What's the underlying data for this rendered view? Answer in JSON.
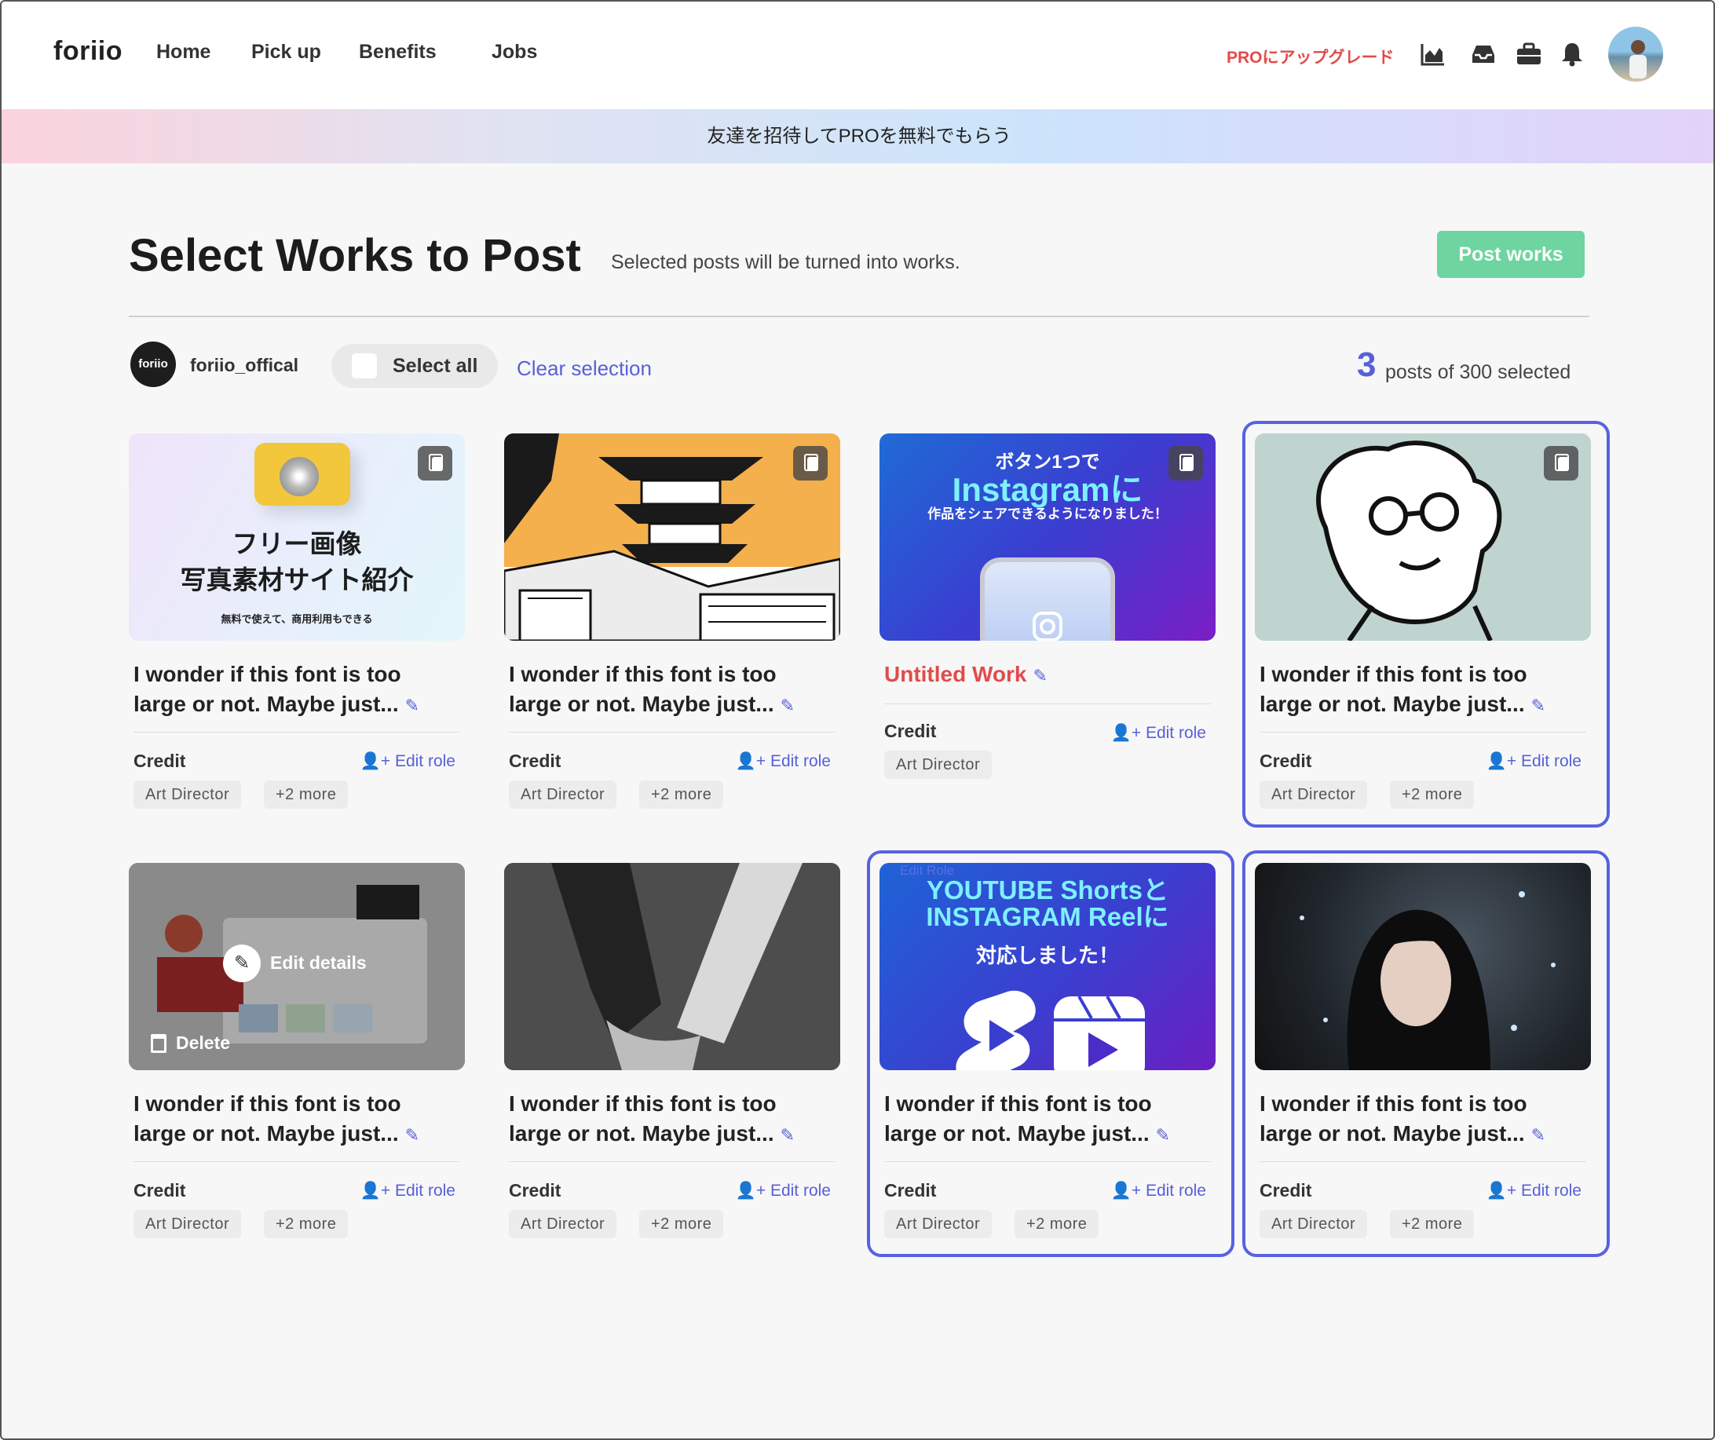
{
  "nav": {
    "logo": "foriio",
    "links": [
      "Home",
      "Pick up",
      "Benefits",
      "Jobs"
    ],
    "upgrade": "PROにアップグレード",
    "icons": [
      "chart-icon",
      "inbox-icon",
      "briefcase-icon",
      "bell-icon"
    ]
  },
  "banner": {
    "text": "友達を招待してPROを無料でもらう"
  },
  "header": {
    "title": "Select Works to Post",
    "subtitle": "Selected posts will be turned into works.",
    "post_button": "Post works"
  },
  "toolbar": {
    "account_logo": "foriio",
    "account_name": "foriio_offical",
    "select_all": "Select all",
    "clear_selection": "Clear selection",
    "selected_count": "3",
    "selected_text": "posts of 300 selected"
  },
  "cards": [
    {
      "title": "I wonder if this font is too large or not. Maybe just...",
      "credit": "Credit",
      "edit_role": "Edit role",
      "role": "Art Director",
      "more": "+2 more",
      "selected": false,
      "thumb_text": [
        "フリー画像",
        "写真素材サイト紹介",
        "無料で使えて、商用利用もできる"
      ]
    },
    {
      "title": "I wonder if this font is too large or not. Maybe just...",
      "credit": "Credit",
      "edit_role": "Edit role",
      "role": "Art Director",
      "more": "+2 more",
      "selected": false
    },
    {
      "title": "Untitled Work",
      "credit": "Credit",
      "edit_role": "Edit role",
      "role": "Art Director",
      "more": "",
      "selected": false,
      "thumb_text": [
        "ボタン1つで",
        "Instagramに",
        "作品をシェアできるようになりました！"
      ]
    },
    {
      "title": "I wonder if this font is too large or not. Maybe just...",
      "credit": "Credit",
      "edit_role": "Edit role",
      "role": "Art Director",
      "more": "+2 more",
      "selected": true
    },
    {
      "title": "I wonder if this font is too large or not. Maybe just...",
      "credit": "Credit",
      "edit_role": "Edit role",
      "role": "Art Director",
      "more": "+2 more",
      "selected": false,
      "overlay": {
        "edit": "Edit details",
        "delete": "Delete"
      }
    },
    {
      "title": "I wonder if this font is too large or not. Maybe just...",
      "credit": "Credit",
      "edit_role": "Edit role",
      "role": "Art Director",
      "more": "+2 more",
      "selected": false
    },
    {
      "title": "I wonder if this font is too large or not. Maybe just...",
      "credit": "Credit",
      "edit_role": "Edit role",
      "role": "Art Director",
      "more": "+2 more",
      "selected": true,
      "thumb_text": [
        "YOUTUBE Shortsと",
        "INSTAGRAM Reelに",
        "対応しました！"
      ],
      "ghost": "Edit Role"
    },
    {
      "title": "I wonder if this font is too large or not. Maybe just...",
      "credit": "Credit",
      "edit_role": "Edit role",
      "role": "Art Director",
      "more": "+2 more",
      "selected": true
    }
  ],
  "colors": {
    "accent": "#5860d8",
    "post_button": "#6ed5a0",
    "upgrade": "#e24b4b",
    "untitled": "#e24b4b"
  }
}
